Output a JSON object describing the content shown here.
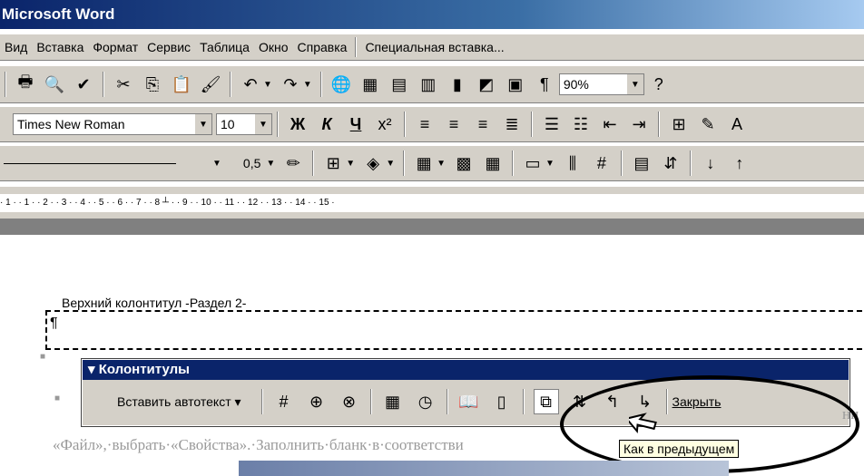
{
  "window": {
    "title": "Microsoft Word"
  },
  "menu": [
    "Вид",
    "Вставка",
    "Формат",
    "Сервис",
    "Таблица",
    "Окно",
    "Справка"
  ],
  "menu_extra": "Специальная вставка...",
  "toolbar": {
    "zoom": "90%"
  },
  "formatting": {
    "font": "Times New Roman",
    "size": "10",
    "bold": "Ж",
    "italic": "К",
    "underline": "Ч"
  },
  "tables_borders": {
    "line_width": "0,5"
  },
  "ruler": {
    "marks": "· 1 · · 1 · · 2 · · 3 · · 4 · · 5 · · 6 · · 7 · · 8 ┴ · · 9 · · 10 · · 11 · · 12 · · 13 · · 14 · · 15 ·"
  },
  "document": {
    "header_label": "Верхний колонтитул -Раздел 2-",
    "pilcrow": "¶",
    "body_text": "«Файл»,·выбрать·«Свойства».·Заполнить·бланк·в·соответстви",
    "right_fragment": "ни"
  },
  "header_footer_toolbar": {
    "title": "▾ Колонтитулы",
    "insert_autotext": "Вставить автотекст ▾",
    "close": "Закрыть",
    "tooltip": "Как в предыдущем"
  }
}
